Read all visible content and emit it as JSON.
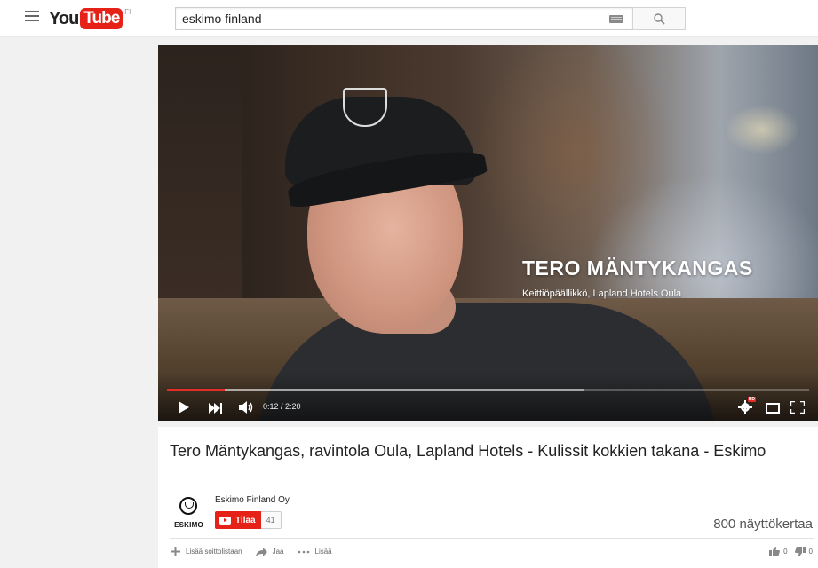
{
  "masthead": {
    "logo_you": "You",
    "logo_tube": "Tube",
    "logo_country": "FI",
    "search_value": "eskimo finland"
  },
  "player": {
    "lower_third_name": "TERO MÄNTYKANGAS",
    "lower_third_subtitle": "Keittiöpäällikkö, Lapland Hotels Oula",
    "time_display": "0:12 / 2:20",
    "progress_played_fraction": 0.09,
    "progress_buffered_fraction": 0.65,
    "hd_badge": "HD",
    "accent_color": "#e52d27"
  },
  "video": {
    "title": "Tero Mäntykangas, ravintola Oula, Lapland Hotels - Kulissit kokkien takana - Eskimo",
    "channel_name": "Eskimo Finland Oy",
    "channel_logo_text": "ESKIMO",
    "subscribe_label": "Tilaa",
    "subscriber_count": "41",
    "views": "800 näyttökertaa",
    "actions": {
      "add_to_playlist": "Lisää soittolistaan",
      "share": "Jaa",
      "more": "Lisää"
    },
    "likes": "0",
    "dislikes": "0"
  }
}
